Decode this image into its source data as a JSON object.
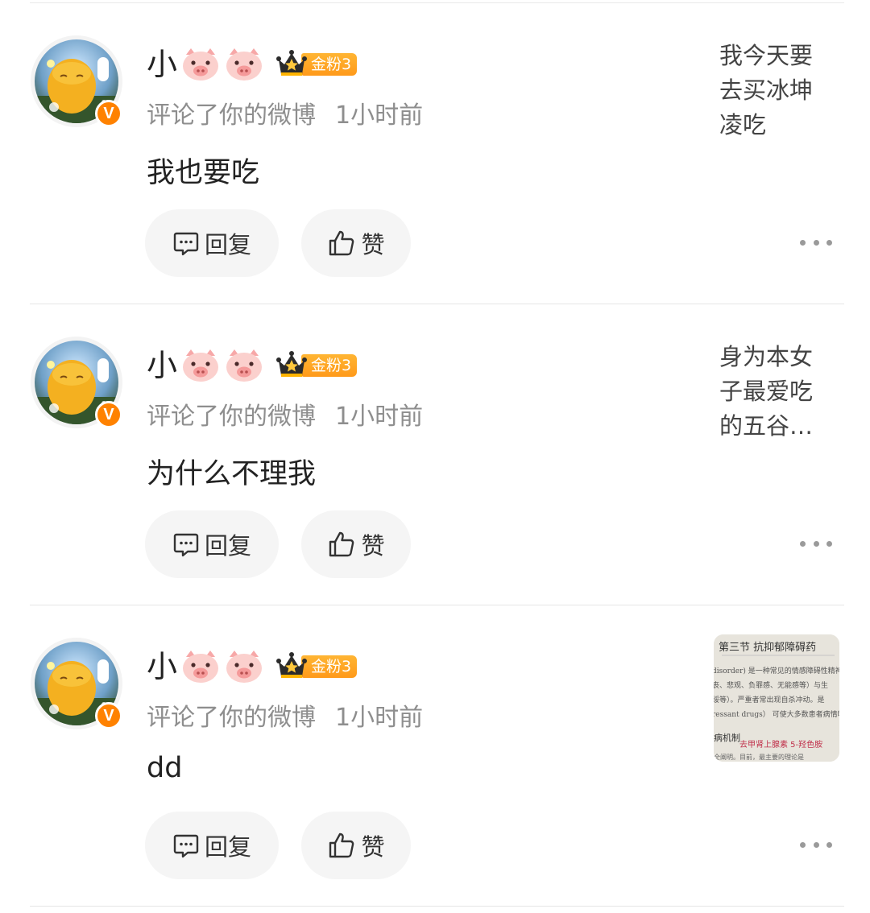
{
  "notifications": [
    {
      "username": "小",
      "fan_badge": "金粉3",
      "action": "评论了你的微博",
      "time": "1小时前",
      "comment": "我也要吃",
      "reply_label": "回复",
      "like_label": "赞",
      "preview_text": "我今天要去买冰坤凌吃"
    },
    {
      "username": "小",
      "fan_badge": "金粉3",
      "action": "评论了你的微博",
      "time": "1小时前",
      "comment": "为什么不理我",
      "reply_label": "回复",
      "like_label": "赞",
      "preview_text": "身为本女子最爱吃的五谷…"
    },
    {
      "username": "小",
      "fan_badge": "金粉3",
      "action": "评论了你的微博",
      "time": "1小时前",
      "comment": "dd",
      "reply_label": "回复",
      "like_label": "赞",
      "preview_image": {
        "title": "第三节 抗抑郁障碍药",
        "lines": [
          "disorder) 是一种常见的情感障碍性精神",
          "丧、悲观、负罪感、无能感等）与生",
          "绥等）。严重者常出现自杀冲动。是",
          "ressant drugs） 可使大多数患者病情明",
          "病机制",
          "去甲肾上腺素 5-羟色胺",
          "全阐明。目前，最主要的理论是"
        ]
      }
    }
  ],
  "icons": {
    "comment": "comment-bubble-icon",
    "like": "thumbs-up-icon",
    "more": "more-dots-icon",
    "verified": "verified-v-icon",
    "crown": "crown-icon",
    "pig": "pig-emoji-icon"
  },
  "verified_mark": "V",
  "colors": {
    "accent": "#ff8200",
    "badge": "#ffa726",
    "button_bg": "#f5f5f5",
    "meta_text": "#8e8e8e"
  }
}
